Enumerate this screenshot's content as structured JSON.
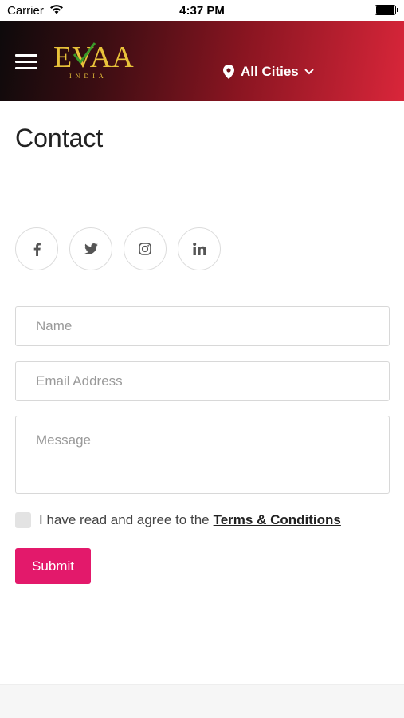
{
  "status_bar": {
    "carrier": "Carrier",
    "time": "4:37 PM"
  },
  "header": {
    "logo_text": "EVAA",
    "logo_subtext": "INDIA",
    "city_selector": "All Cities",
    "gradient_colors": [
      "#0d0a0b",
      "#8a1521",
      "#d9263a"
    ]
  },
  "main": {
    "title": "Contact",
    "social_icons": [
      "facebook-icon",
      "twitter-icon",
      "instagram-icon",
      "linkedin-icon"
    ],
    "form": {
      "name_placeholder": "Name",
      "email_placeholder": "Email Address",
      "message_placeholder": "Message",
      "agree_text": "I have read and agree to the",
      "terms_link": "Terms & Conditions",
      "submit_label": "Submit",
      "submit_color": "#e3196b"
    }
  }
}
